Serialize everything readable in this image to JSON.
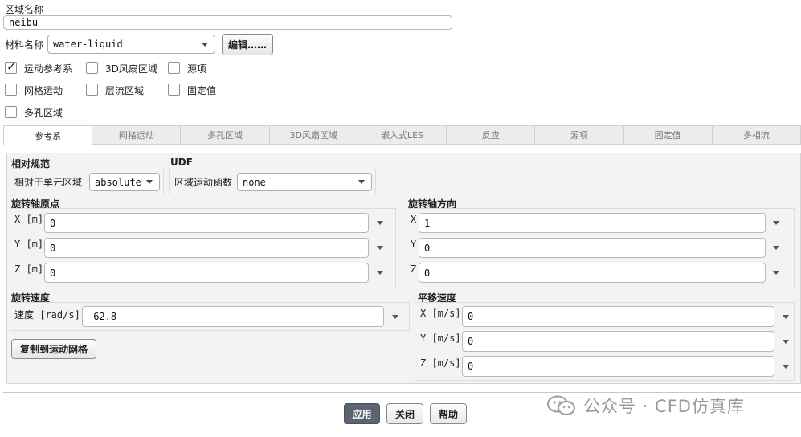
{
  "zone": {
    "name_label": "区域名称",
    "name_value": "neibu",
    "material_label": "材料名称",
    "material_value": "water-liquid",
    "edit_button": "编辑……"
  },
  "options": [
    {
      "label": "运动参考系",
      "checked": true
    },
    {
      "label": "3D风扇区域",
      "checked": false
    },
    {
      "label": "源项",
      "checked": false
    },
    {
      "label": "网格运动",
      "checked": false
    },
    {
      "label": "层流区域",
      "checked": false
    },
    {
      "label": "固定值",
      "checked": false
    },
    {
      "label": "多孔区域",
      "checked": false
    }
  ],
  "tabs": [
    "参考系",
    "网格运动",
    "多孔区域",
    "3D风扇区域",
    "嵌入式LES",
    "反应",
    "源项",
    "固定值",
    "多相流"
  ],
  "active_tab": "参考系",
  "relative": {
    "title": "相对规范",
    "label": "相对于单元区域",
    "value": "absolute"
  },
  "udf": {
    "title": "UDF",
    "label": "区域运动函数",
    "value": "none"
  },
  "origin": {
    "title": "旋转轴原点",
    "rows": [
      {
        "label": "X [m]",
        "value": "0"
      },
      {
        "label": "Y [m]",
        "value": "0"
      },
      {
        "label": "Z [m]",
        "value": "0"
      }
    ]
  },
  "direction": {
    "title": "旋转轴方向",
    "rows": [
      {
        "label": "X",
        "value": "1"
      },
      {
        "label": "Y",
        "value": "0"
      },
      {
        "label": "Z",
        "value": "0"
      }
    ]
  },
  "rotation": {
    "title": "旋转速度",
    "label": "速度 [rad/s]",
    "value": "-62.8",
    "copy_button": "复制到运动网格"
  },
  "translation": {
    "title": "平移速度",
    "rows": [
      {
        "label": "X [m/s]",
        "value": "0"
      },
      {
        "label": "Y [m/s]",
        "value": "0"
      },
      {
        "label": "Z [m/s]",
        "value": "0"
      }
    ]
  },
  "buttons": {
    "apply": "应用",
    "close": "关闭",
    "help": "帮助"
  },
  "watermark": "公众号 · CFD仿真库",
  "colors": {
    "apply_bg": "#5b6470",
    "panel_bg": "#f3f3f3"
  }
}
